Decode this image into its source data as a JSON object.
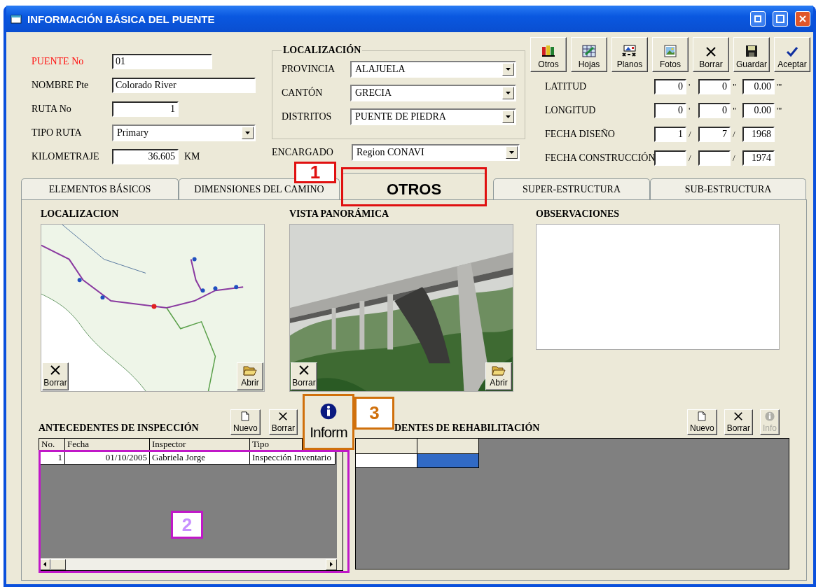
{
  "window": {
    "title": "INFORMACIÓN BÁSICA DEL PUENTE"
  },
  "general": [
    {
      "label": "PUENTE No",
      "value": "01",
      "kind": "text",
      "required": true
    },
    {
      "label": "NOMBRE Pte",
      "value": "Colorado River",
      "kind": "text",
      "required": false
    },
    {
      "label": "RUTA No",
      "value": "1",
      "kind": "number",
      "required": false
    },
    {
      "label": "TIPO RUTA",
      "value": "Primary",
      "kind": "dropdown",
      "required": false
    },
    {
      "label": "KILOMETRAJE",
      "value": "36.605",
      "kind": "number",
      "required": false,
      "unit": "KM"
    }
  ],
  "localizacion": {
    "title": "LOCALIZACIÓN",
    "fields": [
      {
        "label": "PROVINCIA",
        "value": "ALAJUELA"
      },
      {
        "label": "CANTÓN",
        "value": "GRECIA"
      },
      {
        "label": "DISTRITOS",
        "value": "PUENTE DE PIEDRA"
      }
    ]
  },
  "encargado": {
    "label": "ENCARGADO",
    "value": "Region  CONAVI"
  },
  "toolbar": [
    {
      "label": "Otros",
      "kind": "books"
    },
    {
      "label": "Hojas",
      "kind": "sheet"
    },
    {
      "label": "Planos",
      "kind": "plan"
    },
    {
      "label": "Fotos"
    },
    {
      "label": "Borrar",
      "kind": "delete"
    },
    {
      "label": "Guardar",
      "kind": "save"
    },
    {
      "label": "Aceptar",
      "kind": "accept"
    }
  ],
  "coordinates": [
    {
      "label": "LATITUD",
      "fields": [
        {
          "value": "0"
        },
        {
          "value": "0"
        },
        {
          "value": "0.00"
        }
      ],
      "separators": [
        "'",
        "\"",
        "'''"
      ]
    },
    {
      "label": "LONGITUD",
      "fields": [
        {
          "value": "0"
        },
        {
          "value": "0"
        },
        {
          "value": "0.00"
        }
      ],
      "separators": [
        "'",
        "\"",
        "'''"
      ]
    },
    {
      "label": "FECHA DISEÑO",
      "fields": [
        {
          "value": "1"
        },
        {
          "value": "7"
        },
        {
          "value": "1968"
        }
      ],
      "separators": [
        "/",
        "/"
      ]
    },
    {
      "label": "FECHA CONSTRUCCIÓN",
      "fields": [
        {
          "value": "1974"
        }
      ],
      "separators": [
        "/",
        "/"
      ]
    }
  ],
  "tabs": [
    {
      "label": "ELEMENTOS BÁSICOS",
      "selected": false
    },
    {
      "label": "DIMENSIONES DEL CAMINO",
      "selected": false
    },
    {
      "label": "OTROS",
      "selected": true
    },
    {
      "label": "SUPER-ESTRUCTURA",
      "selected": false
    },
    {
      "label": "SUB-ESTRUCTURA",
      "selected": false
    }
  ],
  "panels": [
    {
      "title": "LOCALIZACION",
      "kind": "map",
      "buttons": [
        {
          "label": "Borrar",
          "kind": "delete"
        },
        {
          "label": "Abrir",
          "kind": "open"
        }
      ]
    },
    {
      "title": "VISTA PANORÁMICA",
      "buttons": [
        {
          "label": "Borrar",
          "kind": "delete"
        },
        {
          "label": "Abrir",
          "kind": "open"
        }
      ]
    },
    {
      "title": "OBSERVACIONES",
      "kind": "notes"
    }
  ],
  "inspection": {
    "title": "ANTECEDENTES DE INSPECCIÓN",
    "buttons": [
      {
        "label": "Nuevo",
        "kind": "new",
        "disabled": false
      },
      {
        "label": "Borrar",
        "kind": "delete",
        "disabled": false
      }
    ],
    "columns": [
      "No.",
      "Fecha",
      "Inspector",
      "Tipo"
    ],
    "rows": [
      [
        "1",
        "01/10/2005",
        "Gabriela Jorge",
        "Inspección Inventario"
      ]
    ]
  },
  "info_button": {
    "label": "Inform"
  },
  "rehabilitation": {
    "title": "DENTES DE REHABILITACIÓN",
    "buttons": [
      {
        "label": "Nuevo",
        "kind": "new",
        "disabled": false
      },
      {
        "label": "Borrar",
        "kind": "delete",
        "disabled": false
      },
      {
        "label": "Info",
        "kind": "info",
        "disabled": true
      }
    ],
    "cells": [
      {
        "selected": false
      },
      {
        "selected": true
      }
    ]
  },
  "callouts": [
    {
      "number": "1",
      "color": "#e01010"
    },
    {
      "number": "2",
      "color": "#c018c8"
    },
    {
      "number": "3",
      "color": "#d0700c"
    }
  ]
}
